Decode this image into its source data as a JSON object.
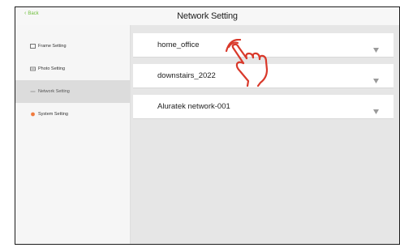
{
  "header": {
    "back_label": "Back",
    "title": "Network Setting"
  },
  "sidebar": {
    "items": [
      {
        "label": "Frame Setting",
        "icon": "frame-icon"
      },
      {
        "label": "Photo Setting",
        "icon": "photo-icon"
      },
      {
        "label": "Network Setting",
        "icon": "network-icon",
        "active": true
      },
      {
        "label": "System Setting",
        "icon": "system-icon"
      }
    ]
  },
  "networks": [
    {
      "name": "home_office",
      "icon": "wifi-icon"
    },
    {
      "name": "downstairs_2022",
      "icon": "wifi-icon"
    },
    {
      "name": "Aluratek network-001",
      "icon": "wifi-icon"
    }
  ],
  "colors": {
    "accent_green": "#6fbf3c",
    "system_orange": "#f07b3f",
    "tap_hand": "#d9392b"
  },
  "overlay": {
    "icon": "tap-hand-icon"
  }
}
